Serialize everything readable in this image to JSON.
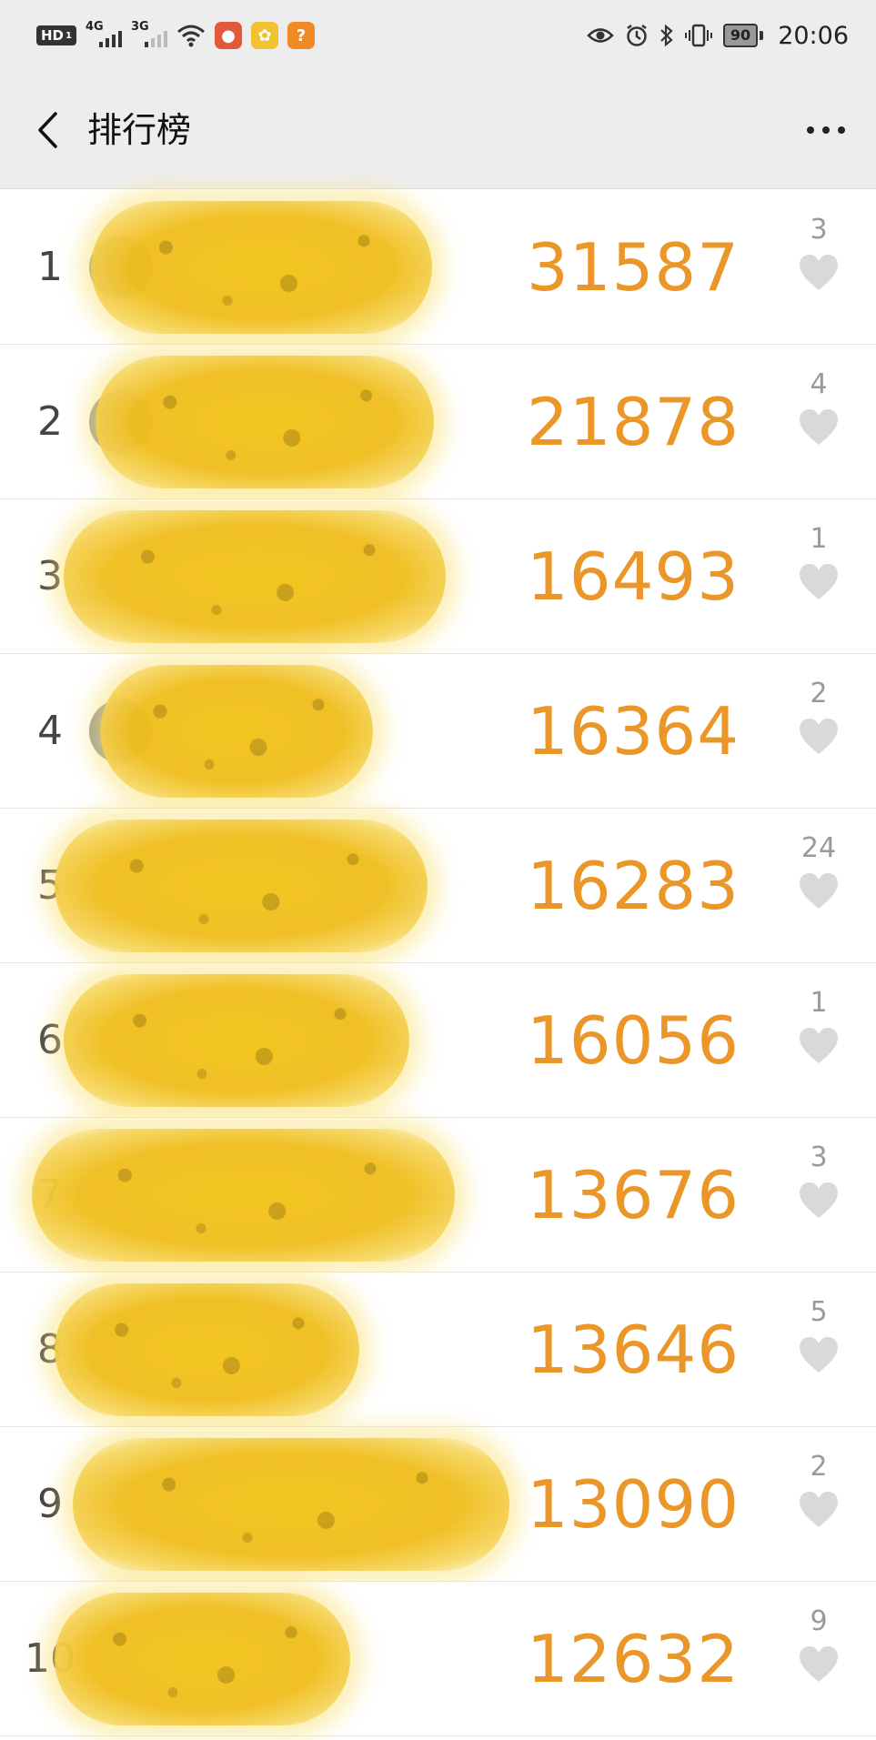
{
  "status_bar": {
    "hd_label": "HD",
    "hd_sub": "1",
    "network_1": "4G",
    "network_2": "3G",
    "battery": "90",
    "time": "20:06"
  },
  "nav": {
    "title": "排行榜",
    "back_icon": "chevron-left-icon",
    "more_icon": "more-dots-icon"
  },
  "colors": {
    "steps": "#eb9628",
    "rank": "#444444",
    "like_count": "#9a9a9a",
    "heart": "#d9d9d9",
    "redaction": "#f0be1f"
  },
  "ranking": [
    {
      "rank": "1",
      "steps": "31587",
      "likes": "3"
    },
    {
      "rank": "2",
      "steps": "21878",
      "likes": "4"
    },
    {
      "rank": "3",
      "steps": "16493",
      "likes": "1"
    },
    {
      "rank": "4",
      "steps": "16364",
      "likes": "2"
    },
    {
      "rank": "5",
      "steps": "16283",
      "likes": "24"
    },
    {
      "rank": "6",
      "steps": "16056",
      "likes": "1"
    },
    {
      "rank": "7",
      "steps": "13676",
      "likes": "3"
    },
    {
      "rank": "8",
      "steps": "13646",
      "likes": "5"
    },
    {
      "rank": "9",
      "steps": "13090",
      "likes": "2"
    },
    {
      "rank": "10",
      "steps": "12632",
      "likes": "9"
    }
  ]
}
